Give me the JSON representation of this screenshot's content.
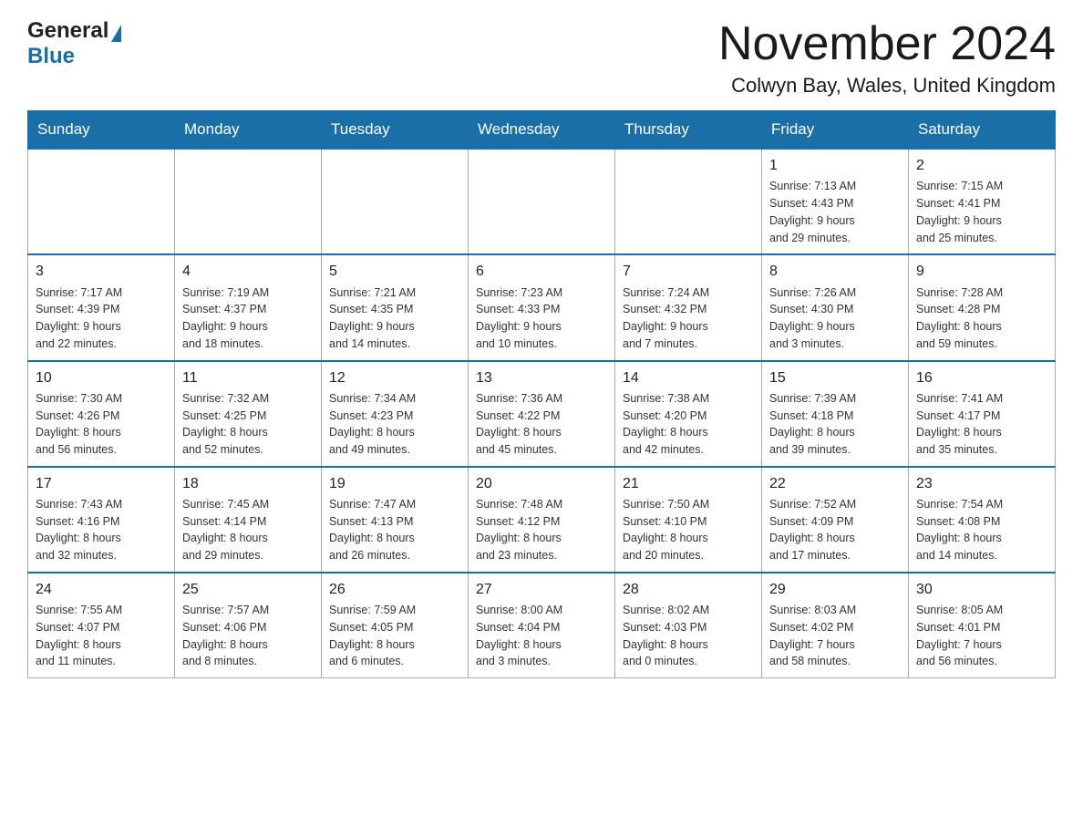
{
  "header": {
    "logo_general": "General",
    "logo_blue": "Blue",
    "title": "November 2024",
    "subtitle": "Colwyn Bay, Wales, United Kingdom"
  },
  "calendar": {
    "days_of_week": [
      "Sunday",
      "Monday",
      "Tuesday",
      "Wednesday",
      "Thursday",
      "Friday",
      "Saturday"
    ],
    "weeks": [
      {
        "days": [
          {
            "number": "",
            "info": "",
            "empty": true
          },
          {
            "number": "",
            "info": "",
            "empty": true
          },
          {
            "number": "",
            "info": "",
            "empty": true
          },
          {
            "number": "",
            "info": "",
            "empty": true
          },
          {
            "number": "",
            "info": "",
            "empty": true
          },
          {
            "number": "1",
            "info": "Sunrise: 7:13 AM\nSunset: 4:43 PM\nDaylight: 9 hours\nand 29 minutes."
          },
          {
            "number": "2",
            "info": "Sunrise: 7:15 AM\nSunset: 4:41 PM\nDaylight: 9 hours\nand 25 minutes."
          }
        ]
      },
      {
        "days": [
          {
            "number": "3",
            "info": "Sunrise: 7:17 AM\nSunset: 4:39 PM\nDaylight: 9 hours\nand 22 minutes."
          },
          {
            "number": "4",
            "info": "Sunrise: 7:19 AM\nSunset: 4:37 PM\nDaylight: 9 hours\nand 18 minutes."
          },
          {
            "number": "5",
            "info": "Sunrise: 7:21 AM\nSunset: 4:35 PM\nDaylight: 9 hours\nand 14 minutes."
          },
          {
            "number": "6",
            "info": "Sunrise: 7:23 AM\nSunset: 4:33 PM\nDaylight: 9 hours\nand 10 minutes."
          },
          {
            "number": "7",
            "info": "Sunrise: 7:24 AM\nSunset: 4:32 PM\nDaylight: 9 hours\nand 7 minutes."
          },
          {
            "number": "8",
            "info": "Sunrise: 7:26 AM\nSunset: 4:30 PM\nDaylight: 9 hours\nand 3 minutes."
          },
          {
            "number": "9",
            "info": "Sunrise: 7:28 AM\nSunset: 4:28 PM\nDaylight: 8 hours\nand 59 minutes."
          }
        ]
      },
      {
        "days": [
          {
            "number": "10",
            "info": "Sunrise: 7:30 AM\nSunset: 4:26 PM\nDaylight: 8 hours\nand 56 minutes."
          },
          {
            "number": "11",
            "info": "Sunrise: 7:32 AM\nSunset: 4:25 PM\nDaylight: 8 hours\nand 52 minutes."
          },
          {
            "number": "12",
            "info": "Sunrise: 7:34 AM\nSunset: 4:23 PM\nDaylight: 8 hours\nand 49 minutes."
          },
          {
            "number": "13",
            "info": "Sunrise: 7:36 AM\nSunset: 4:22 PM\nDaylight: 8 hours\nand 45 minutes."
          },
          {
            "number": "14",
            "info": "Sunrise: 7:38 AM\nSunset: 4:20 PM\nDaylight: 8 hours\nand 42 minutes."
          },
          {
            "number": "15",
            "info": "Sunrise: 7:39 AM\nSunset: 4:18 PM\nDaylight: 8 hours\nand 39 minutes."
          },
          {
            "number": "16",
            "info": "Sunrise: 7:41 AM\nSunset: 4:17 PM\nDaylight: 8 hours\nand 35 minutes."
          }
        ]
      },
      {
        "days": [
          {
            "number": "17",
            "info": "Sunrise: 7:43 AM\nSunset: 4:16 PM\nDaylight: 8 hours\nand 32 minutes."
          },
          {
            "number": "18",
            "info": "Sunrise: 7:45 AM\nSunset: 4:14 PM\nDaylight: 8 hours\nand 29 minutes."
          },
          {
            "number": "19",
            "info": "Sunrise: 7:47 AM\nSunset: 4:13 PM\nDaylight: 8 hours\nand 26 minutes."
          },
          {
            "number": "20",
            "info": "Sunrise: 7:48 AM\nSunset: 4:12 PM\nDaylight: 8 hours\nand 23 minutes."
          },
          {
            "number": "21",
            "info": "Sunrise: 7:50 AM\nSunset: 4:10 PM\nDaylight: 8 hours\nand 20 minutes."
          },
          {
            "number": "22",
            "info": "Sunrise: 7:52 AM\nSunset: 4:09 PM\nDaylight: 8 hours\nand 17 minutes."
          },
          {
            "number": "23",
            "info": "Sunrise: 7:54 AM\nSunset: 4:08 PM\nDaylight: 8 hours\nand 14 minutes."
          }
        ]
      },
      {
        "days": [
          {
            "number": "24",
            "info": "Sunrise: 7:55 AM\nSunset: 4:07 PM\nDaylight: 8 hours\nand 11 minutes."
          },
          {
            "number": "25",
            "info": "Sunrise: 7:57 AM\nSunset: 4:06 PM\nDaylight: 8 hours\nand 8 minutes."
          },
          {
            "number": "26",
            "info": "Sunrise: 7:59 AM\nSunset: 4:05 PM\nDaylight: 8 hours\nand 6 minutes."
          },
          {
            "number": "27",
            "info": "Sunrise: 8:00 AM\nSunset: 4:04 PM\nDaylight: 8 hours\nand 3 minutes."
          },
          {
            "number": "28",
            "info": "Sunrise: 8:02 AM\nSunset: 4:03 PM\nDaylight: 8 hours\nand 0 minutes."
          },
          {
            "number": "29",
            "info": "Sunrise: 8:03 AM\nSunset: 4:02 PM\nDaylight: 7 hours\nand 58 minutes."
          },
          {
            "number": "30",
            "info": "Sunrise: 8:05 AM\nSunset: 4:01 PM\nDaylight: 7 hours\nand 56 minutes."
          }
        ]
      }
    ]
  }
}
